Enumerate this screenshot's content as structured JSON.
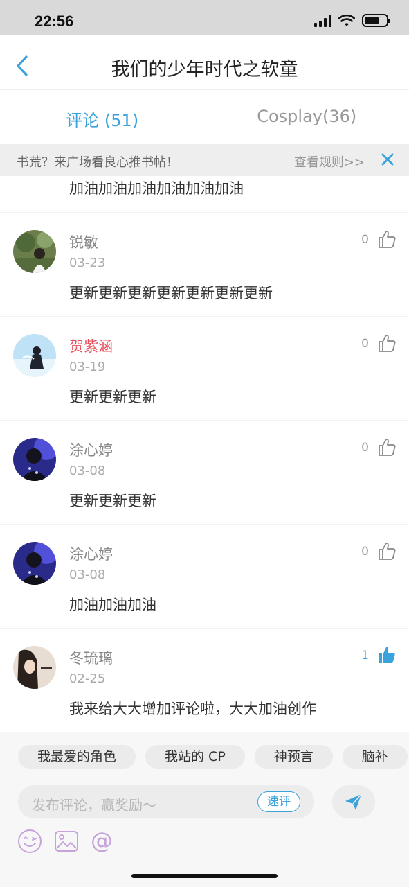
{
  "status_bar": {
    "time": "22:56",
    "battery_level": 0.65
  },
  "nav": {
    "title": "我们的少年时代之软童",
    "back_icon": "chevron-left-icon"
  },
  "tabs": [
    {
      "label": "评论 (51)",
      "active": true
    },
    {
      "label": "Cosplay(36)",
      "active": false
    }
  ],
  "notice": {
    "text": "书荒？来广场看良心推书帖！",
    "link": "查看规则>>",
    "close_icon": "close-icon"
  },
  "partial_comment_text": "加油加油加油加油加油加油",
  "comments": [
    {
      "name": "锐敏",
      "date": "03-23",
      "text": "更新更新更新更新更新更新更新",
      "likes": "0",
      "liked": false,
      "name_color": "#888888"
    },
    {
      "name": "贺紫涵",
      "date": "03-19",
      "text": "更新更新更新",
      "likes": "0",
      "liked": false,
      "name_color": "#e84e5a"
    },
    {
      "name": "涂心婷",
      "date": "03-08",
      "text": "更新更新更新",
      "likes": "0",
      "liked": false,
      "name_color": "#888888"
    },
    {
      "name": "涂心婷",
      "date": "03-08",
      "text": "加油加油加油",
      "likes": "0",
      "liked": false,
      "name_color": "#888888"
    },
    {
      "name": "冬琉璃",
      "date": "02-25",
      "text": "我来给大大增加评论啦，大大加油创作",
      "likes": "1",
      "liked": true,
      "name_color": "#888888"
    }
  ],
  "bottom": {
    "chips": [
      "我最爱的角色",
      "我站的 CP",
      "神预言",
      "脑补"
    ],
    "input_placeholder": "发布评论，赢奖励～",
    "quick_label": "速评"
  },
  "colors": {
    "accent": "#3aa3dc",
    "highlight_name": "#e84e5a",
    "tool_icon": "#c7a3dc"
  }
}
